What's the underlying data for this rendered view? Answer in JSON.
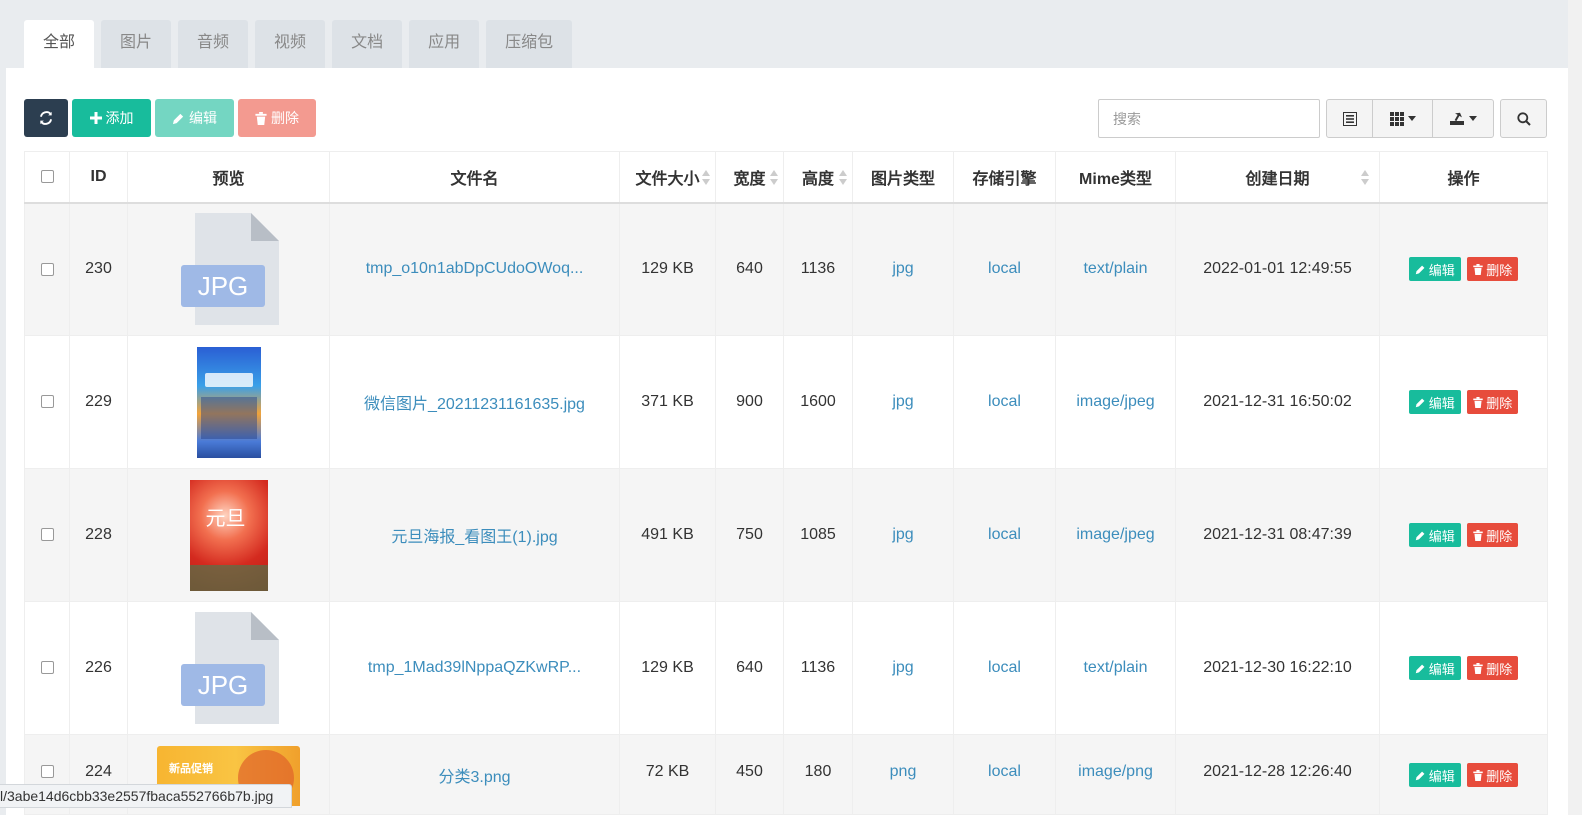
{
  "tabs": [
    "全部",
    "图片",
    "音频",
    "视频",
    "文档",
    "应用",
    "压缩包"
  ],
  "toolbar": {
    "add_label": "添加",
    "edit_label": "编辑",
    "delete_label": "删除",
    "search_placeholder": "搜索"
  },
  "table": {
    "headers": {
      "id": "ID",
      "preview": "预览",
      "filename": "文件名",
      "filesize": "文件大小",
      "width": "宽度",
      "height": "高度",
      "imagetype": "图片类型",
      "storage": "存储引擎",
      "mime": "Mime类型",
      "created": "创建日期",
      "actions": "操作"
    },
    "rows": [
      {
        "id": "230",
        "preview_label": "JPG",
        "filename": "tmp_o10n1abDpCUdoOWoq...",
        "filesize": "129 KB",
        "width": "640",
        "height": "1136",
        "imagetype": "jpg",
        "storage": "local",
        "mime": "text/plain",
        "created": "2022-01-01 12:49:55"
      },
      {
        "id": "229",
        "preview_label": "",
        "filename": "微信图片_20211231161635.jpg",
        "filesize": "371 KB",
        "width": "900",
        "height": "1600",
        "imagetype": "jpg",
        "storage": "local",
        "mime": "image/jpeg",
        "created": "2021-12-31 16:50:02"
      },
      {
        "id": "228",
        "preview_label": "元旦",
        "filename": "元旦海报_看图王(1).jpg",
        "filesize": "491 KB",
        "width": "750",
        "height": "1085",
        "imagetype": "jpg",
        "storage": "local",
        "mime": "image/jpeg",
        "created": "2021-12-31 08:47:39"
      },
      {
        "id": "226",
        "preview_label": "JPG",
        "filename": "tmp_1Mad39lNppaQZKwRP...",
        "filesize": "129 KB",
        "width": "640",
        "height": "1136",
        "imagetype": "jpg",
        "storage": "local",
        "mime": "text/plain",
        "created": "2021-12-30 16:22:10"
      },
      {
        "id": "224",
        "preview_label": "新品促销",
        "filename": "分类3.png",
        "filesize": "72 KB",
        "width": "450",
        "height": "180",
        "imagetype": "png",
        "storage": "local",
        "mime": "image/png",
        "created": "2021-12-28 12:26:40"
      }
    ],
    "row_edit_label": "编辑",
    "row_delete_label": "删除"
  },
  "statusbar": {
    "url": "l/3abe14d6cbb33e2557fbaca552766b7b.jpg"
  },
  "colors": {
    "primary_dark": "#2c3e50",
    "success": "#18bc9c",
    "danger": "#e74c3c",
    "link": "#3c8dbc"
  }
}
